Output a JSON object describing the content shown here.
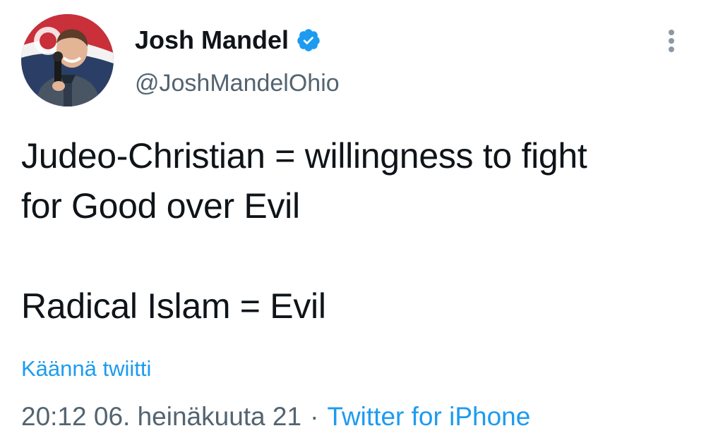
{
  "author": {
    "display_name": "Josh Mandel",
    "handle": "@JoshMandelOhio",
    "verified": true,
    "avatar_icon": "avatar-photo"
  },
  "tweet": {
    "lines": [
      "Judeo-Christian = willingness to fight",
      "for Good over Evil",
      "Radical Islam = Evil"
    ],
    "translate_label": "Käännä twiitti",
    "timestamp": "20:12 06. heinäkuuta 21",
    "separator": "·",
    "source": "Twitter for iPhone"
  },
  "colors": {
    "text": "#0f1419",
    "secondary": "#536471",
    "accent": "#1d9bf0"
  },
  "icons": {
    "verified": "verified-badge-icon",
    "more": "more-options-icon"
  }
}
